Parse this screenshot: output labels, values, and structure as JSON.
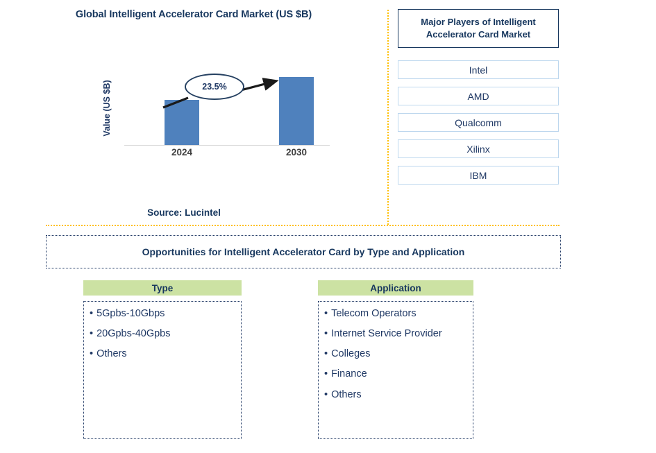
{
  "chart": {
    "title": "Global Intelligent Accelerator Card Market (US $B)",
    "source": "Source: Lucintel"
  },
  "chart_data": {
    "type": "bar",
    "title": "Global Intelligent Accelerator Card Market (US $B)",
    "categories": [
      "2024",
      "2030"
    ],
    "values": [
      59,
      89
    ],
    "ylabel": "Value (US $B)",
    "xlabel": "",
    "bar_color": "#4F81BD",
    "grid": false,
    "legend": false,
    "annotations": [
      {
        "text": "23.5%",
        "type": "cagr-callout",
        "from": "2024",
        "to": "2030"
      }
    ]
  },
  "players": {
    "title": "Major Players of Intelligent Accelerator Card Market",
    "items": [
      {
        "name": "Intel"
      },
      {
        "name": "AMD"
      },
      {
        "name": "Qualcomm"
      },
      {
        "name": "Xilinx"
      },
      {
        "name": "IBM"
      }
    ]
  },
  "opportunities": {
    "banner": "Opportunities for Intelligent Accelerator Card by Type and Application",
    "columns": [
      {
        "header": "Type",
        "items": [
          "5Gpbs-10Gbps",
          "20Gpbs-40Gpbs",
          "Others"
        ]
      },
      {
        "header": "Application",
        "items": [
          "Telecom Operators",
          "Internet Service Provider",
          "Colleges",
          "Finance",
          "Others"
        ]
      }
    ]
  },
  "colors": {
    "bar": "#4F81BD",
    "title_navy": "#17375E",
    "text_navy": "#1F3864",
    "divider_gold": "#FFC000",
    "header_green": "#CCE2A3",
    "player_border": "#BDD7EE"
  }
}
